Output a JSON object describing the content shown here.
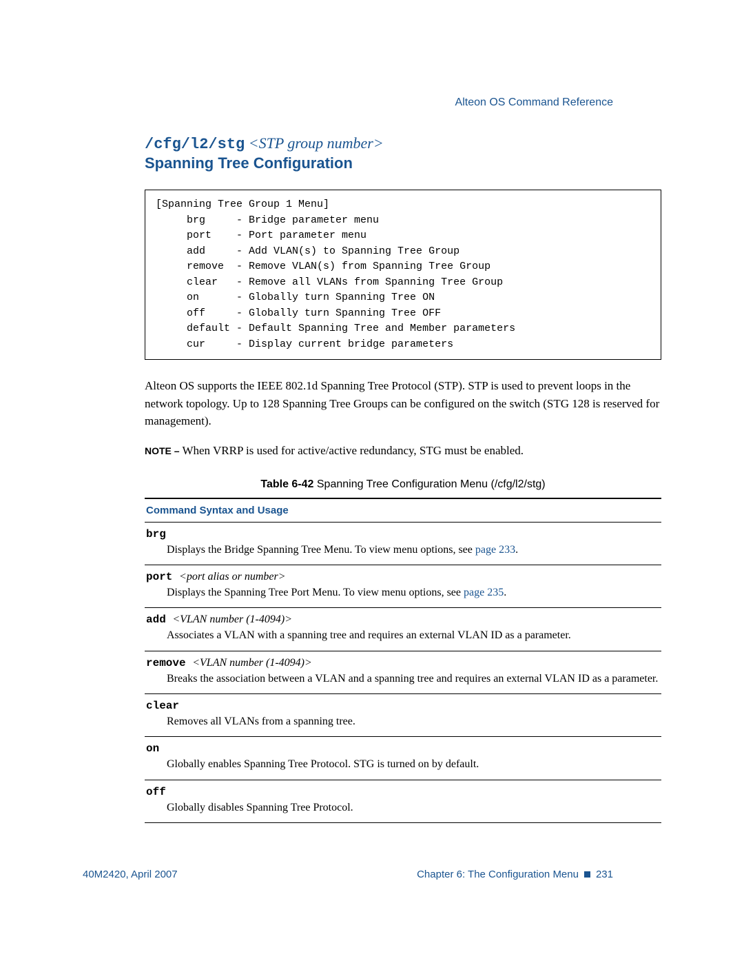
{
  "header": {
    "doc_title": "Alteon OS  Command Reference"
  },
  "title": {
    "cmd": "/cfg/l2/stg",
    "param": " <STP group number>",
    "sub": "Spanning Tree Configuration"
  },
  "codebox": "[Spanning Tree Group 1 Menu]\n     brg     - Bridge parameter menu\n     port    - Port parameter menu\n     add     - Add VLAN(s) to Spanning Tree Group\n     remove  - Remove VLAN(s) from Spanning Tree Group\n     clear   - Remove all VLANs from Spanning Tree Group\n     on      - Globally turn Spanning Tree ON\n     off     - Globally turn Spanning Tree OFF\n     default - Default Spanning Tree and Member parameters\n     cur     - Display current bridge parameters",
  "body": {
    "p1": "Alteon OS supports the IEEE 802.1d Spanning Tree Protocol (STP). STP is used to prevent loops in the network topology. Up to 128 Spanning Tree Groups can be configured on the switch (STG 128 is reserved for management).",
    "note_label": "NOTE – ",
    "note_text": "When VRRP is used for active/active redundancy, STG must be enabled."
  },
  "table": {
    "caption_bold": "Table 6-42 ",
    "caption_text": " Spanning Tree Configuration Menu (/cfg/l2/stg)",
    "header": "Command Syntax and Usage",
    "rows": [
      {
        "cmd": "brg",
        "param": "",
        "desc_pre": "Displays the Bridge Spanning Tree Menu. To view menu options, see ",
        "link": "page 233",
        "desc_post": "."
      },
      {
        "cmd": "port ",
        "param": " <port alias or number>",
        "desc_pre": "Displays the Spanning Tree Port Menu. To view menu options, see ",
        "link": "page 235",
        "desc_post": "."
      },
      {
        "cmd": "add ",
        "param": " <VLAN number (1-4094)>",
        "desc_pre": "Associates a VLAN with a spanning tree and requires an external VLAN ID as a parameter.",
        "link": "",
        "desc_post": ""
      },
      {
        "cmd": "remove ",
        "param": " <VLAN number (1-4094)>",
        "desc_pre": "Breaks the association between a VLAN and a spanning tree and requires an external VLAN ID as a parameter.",
        "link": "",
        "desc_post": ""
      },
      {
        "cmd": "clear",
        "param": "",
        "desc_pre": "Removes all VLANs from a spanning tree.",
        "link": "",
        "desc_post": ""
      },
      {
        "cmd": "on",
        "param": "",
        "desc_pre": "Globally enables Spanning Tree Protocol. STG is turned on by default.",
        "link": "",
        "desc_post": ""
      },
      {
        "cmd": "off",
        "param": "",
        "desc_pre": "Globally disables Spanning Tree Protocol.",
        "link": "",
        "desc_post": ""
      }
    ]
  },
  "footer": {
    "left": "40M2420, April 2007",
    "chapter": "Chapter 6:  The Configuration Menu",
    "page": "231"
  }
}
